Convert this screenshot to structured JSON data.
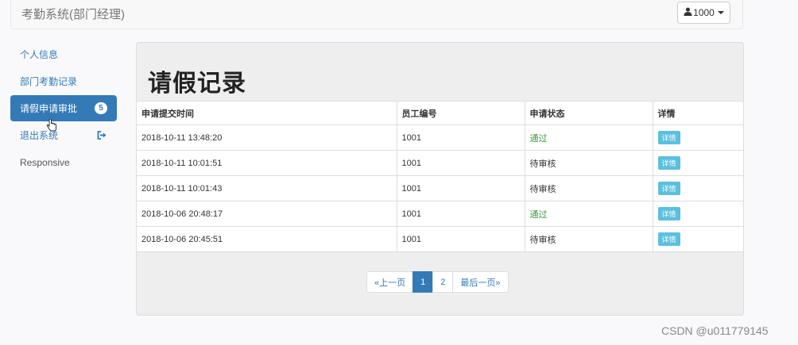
{
  "navbar": {
    "brand": "考勤系统(部门经理)",
    "user_label": "1000"
  },
  "sidebar": {
    "items": [
      {
        "label": "个人信息"
      },
      {
        "label": "部门考勤记录"
      },
      {
        "label": "请假申请审批",
        "badge": "5"
      },
      {
        "label": "退出系统"
      },
      {
        "label": "Responsive"
      }
    ]
  },
  "main": {
    "title": "请假记录",
    "columns": [
      "申请提交时间",
      "员工编号",
      "申请状态",
      "详情"
    ],
    "rows": [
      {
        "time": "2018-10-11 13:48:20",
        "emp": "1001",
        "status": "通过",
        "detail": "详情"
      },
      {
        "time": "2018-10-11 10:01:51",
        "emp": "1001",
        "status": "待审核",
        "detail": "详情"
      },
      {
        "time": "2018-10-11 10:01:43",
        "emp": "1001",
        "status": "待审核",
        "detail": "详情"
      },
      {
        "time": "2018-10-06 20:48:17",
        "emp": "1001",
        "status": "通过",
        "detail": "详情"
      },
      {
        "time": "2018-10-06 20:45:51",
        "emp": "1001",
        "status": "待审核",
        "detail": "详情"
      }
    ],
    "pagination": {
      "prev": "«上一页",
      "pages": [
        "1",
        "2"
      ],
      "current": "1",
      "last": "最后一页»"
    }
  },
  "watermark": "CSDN @u011779145",
  "colors": {
    "primary": "#337ab7",
    "info": "#5bc0de",
    "success_text": "#3c9a3c"
  },
  "icons": {
    "user": "user-icon",
    "logout": "logout-icon",
    "cursor": "hand-pointer-icon"
  }
}
